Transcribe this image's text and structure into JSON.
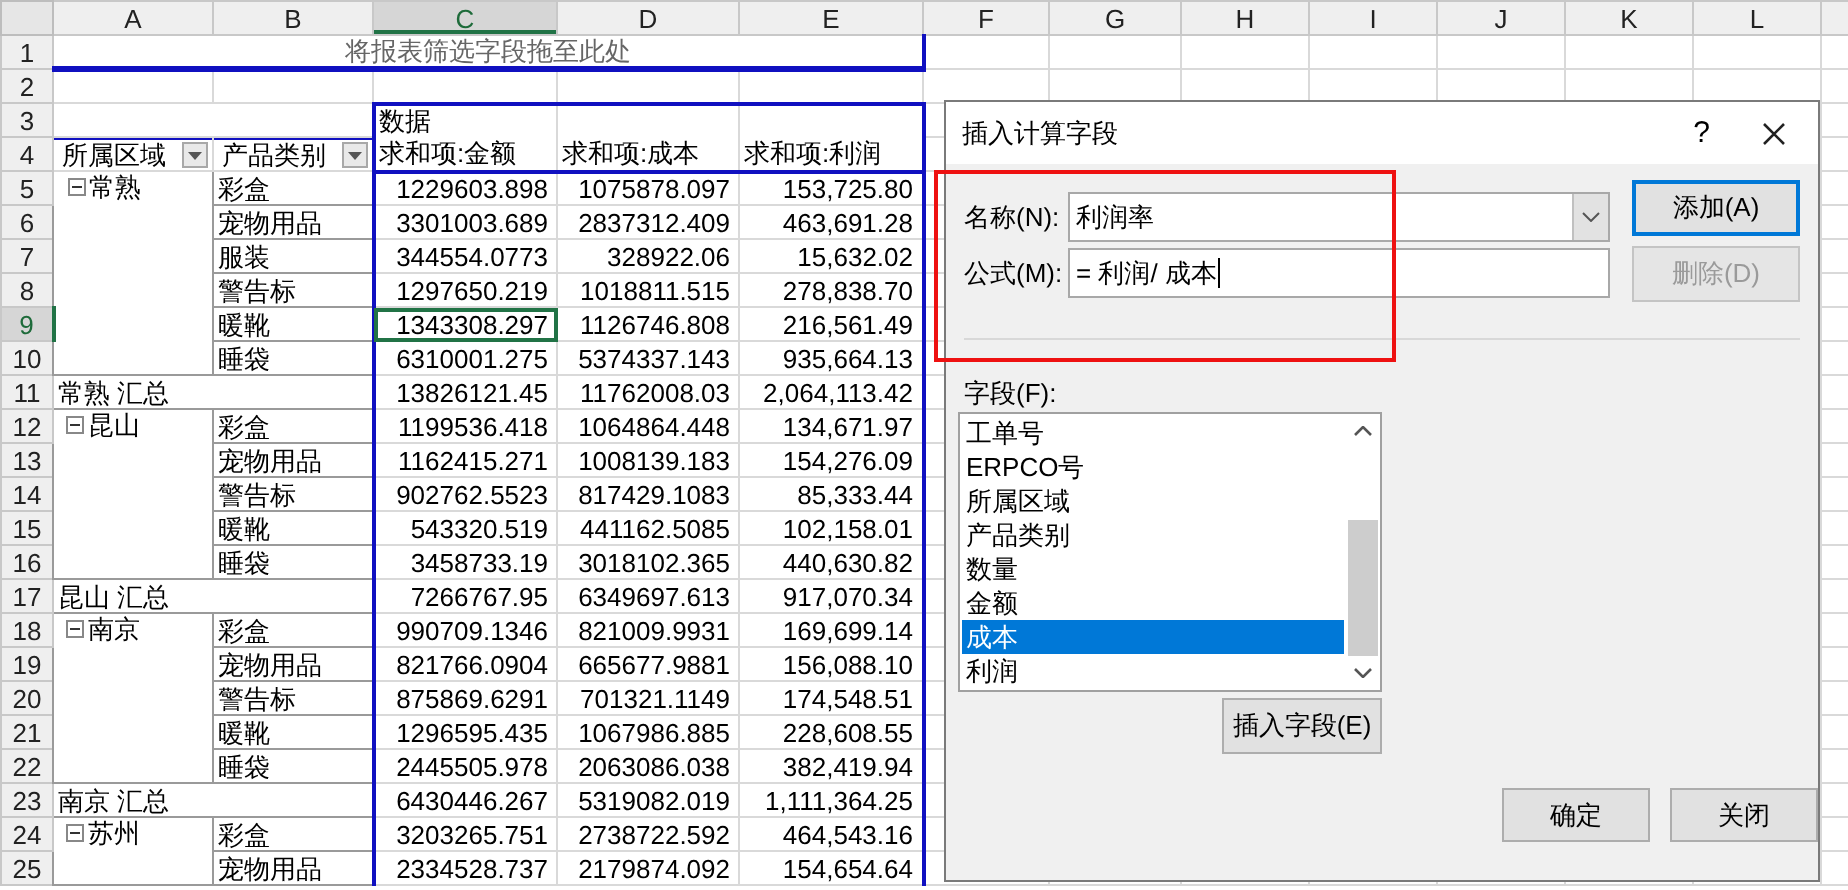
{
  "sheet": {
    "columns": [
      {
        "label": "A",
        "active": false
      },
      {
        "label": "B",
        "active": false
      },
      {
        "label": "C",
        "active": true
      },
      {
        "label": "D",
        "active": false
      },
      {
        "label": "E",
        "active": false
      },
      {
        "label": "F",
        "active": false
      },
      {
        "label": "G",
        "active": false
      },
      {
        "label": "H",
        "active": false
      },
      {
        "label": "I",
        "active": false
      },
      {
        "label": "J",
        "active": false
      },
      {
        "label": "K",
        "active": false
      },
      {
        "label": "L",
        "active": false
      }
    ],
    "header_row_numbers": [
      "1",
      "2",
      "3",
      "4"
    ],
    "filter_drop_zone": "将报表筛选字段拖至此处",
    "data_caption": "数据",
    "row_headers": [
      {
        "text": "所属区域",
        "filter": true
      },
      {
        "text": "产品类别",
        "filter": true
      }
    ],
    "value_headers": [
      "求和项:金额",
      "求和项:成本",
      "求和项:利润"
    ],
    "groups": [
      {
        "region": "常熟",
        "expanded": true,
        "items": [
          {
            "number": "5",
            "category": "彩盒",
            "values": [
              "1229603.898",
              "1075878.097",
              "153,725.80"
            ],
            "active": false
          },
          {
            "number": "6",
            "category": "宠物用品",
            "values": [
              "3301003.689",
              "2837312.409",
              "463,691.28"
            ],
            "active": false
          },
          {
            "number": "7",
            "category": "服装",
            "values": [
              "344554.0773",
              "328922.06",
              "15,632.02"
            ],
            "active": false
          },
          {
            "number": "8",
            "category": "警告标",
            "values": [
              "1297650.219",
              "1018811.515",
              "278,838.70"
            ],
            "active": false
          },
          {
            "number": "9",
            "category": "暖靴",
            "values": [
              "1343308.297",
              "1126746.808",
              "216,561.49"
            ],
            "active": true
          },
          {
            "number": "10",
            "category": "睡袋",
            "values": [
              "6310001.275",
              "5374337.143",
              "935,664.13"
            ],
            "active": false
          }
        ],
        "subtotal": {
          "number": "11",
          "label": "常熟 汇总",
          "values": [
            "13826121.45",
            "11762008.03",
            "2,064,113.42"
          ]
        }
      },
      {
        "region": "昆山",
        "expanded": true,
        "items": [
          {
            "number": "12",
            "category": "彩盒",
            "values": [
              "1199536.418",
              "1064864.448",
              "134,671.97"
            ],
            "active": false
          },
          {
            "number": "13",
            "category": "宠物用品",
            "values": [
              "1162415.271",
              "1008139.183",
              "154,276.09"
            ],
            "active": false
          },
          {
            "number": "14",
            "category": "警告标",
            "values": [
              "902762.5523",
              "817429.1083",
              "85,333.44"
            ],
            "active": false
          },
          {
            "number": "15",
            "category": "暖靴",
            "values": [
              "543320.519",
              "441162.5085",
              "102,158.01"
            ],
            "active": false
          },
          {
            "number": "16",
            "category": "睡袋",
            "values": [
              "3458733.19",
              "3018102.365",
              "440,630.82"
            ],
            "active": false
          }
        ],
        "subtotal": {
          "number": "17",
          "label": "昆山 汇总",
          "values": [
            "7266767.95",
            "6349697.613",
            "917,070.34"
          ]
        }
      },
      {
        "region": "南京",
        "expanded": true,
        "items": [
          {
            "number": "18",
            "category": "彩盒",
            "values": [
              "990709.1346",
              "821009.9931",
              "169,699.14"
            ],
            "active": false
          },
          {
            "number": "19",
            "category": "宠物用品",
            "values": [
              "821766.0904",
              "665677.9881",
              "156,088.10"
            ],
            "active": false
          },
          {
            "number": "20",
            "category": "警告标",
            "values": [
              "875869.6291",
              "701321.1149",
              "174,548.51"
            ],
            "active": false
          },
          {
            "number": "21",
            "category": "暖靴",
            "values": [
              "1296595.435",
              "1067986.885",
              "228,608.55"
            ],
            "active": false
          },
          {
            "number": "22",
            "category": "睡袋",
            "values": [
              "2445505.978",
              "2063086.038",
              "382,419.94"
            ],
            "active": false
          }
        ],
        "subtotal": {
          "number": "23",
          "label": "南京 汇总",
          "values": [
            "6430446.267",
            "5319082.019",
            "1,111,364.25"
          ]
        }
      },
      {
        "region": "苏州",
        "expanded": true,
        "items": [
          {
            "number": "24",
            "category": "彩盒",
            "values": [
              "3203265.751",
              "2738722.592",
              "464,543.16"
            ],
            "active": false
          },
          {
            "number": "25",
            "category": "宠物用品",
            "values": [
              "2334528.737",
              "2179874.092",
              "154,654.64"
            ],
            "active": false
          }
        ]
      }
    ]
  },
  "dialog": {
    "title": "插入计算字段",
    "help": "?",
    "name_field": {
      "label": "名称(N):",
      "value": "利润率"
    },
    "formula_field": {
      "label": "公式(M):",
      "value": "= 利润/ 成本"
    },
    "add_button": {
      "label": "添加(A)",
      "default": true,
      "disabled": false
    },
    "delete_button": {
      "label": "删除(D)",
      "default": false,
      "disabled": true
    },
    "fields_label": "字段(F):",
    "fields": [
      {
        "label": "工单号",
        "selected": false
      },
      {
        "label": "ERPCO号",
        "selected": false
      },
      {
        "label": "所属区域",
        "selected": false
      },
      {
        "label": "产品类别",
        "selected": false
      },
      {
        "label": "数量",
        "selected": false
      },
      {
        "label": "金额",
        "selected": false
      },
      {
        "label": "成本",
        "selected": true
      },
      {
        "label": "利润",
        "selected": false
      }
    ],
    "insert_button": "插入字段(E)",
    "ok_button": "确定",
    "close_button": "关闭"
  },
  "annotations": [
    {
      "kind": "rectangle"
    }
  ]
}
